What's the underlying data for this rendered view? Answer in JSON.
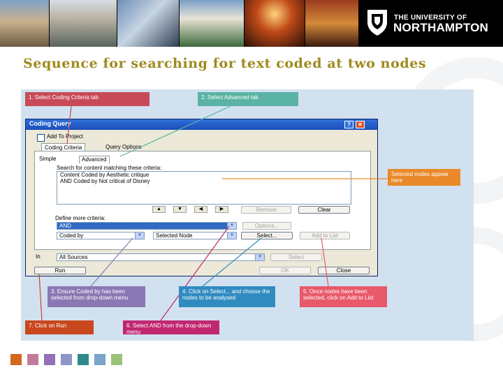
{
  "header": {
    "university_line1": "THE UNIVERSITY OF",
    "university_line2": "NORTHAMPTON"
  },
  "slide": {
    "title": "Sequence for searching for text coded at two nodes"
  },
  "dialog": {
    "title": "Coding Query",
    "help_button": "?",
    "close_button": "✕",
    "add_to_project_label": "Add To Project",
    "tabs": [
      "Coding Criteria",
      "Query Options"
    ],
    "subtabs": [
      "Simple",
      "Advanced"
    ],
    "search_label": "Search for content matching these criteria:",
    "criteria_lines": [
      "Content Coded by Aesthetic critique",
      "AND Coded by Not critical of Disney"
    ],
    "arrow_buttons": [
      "▲",
      "▼",
      "◀",
      "▶"
    ],
    "remove_button": "Remove",
    "clear_button": "Clear",
    "define_label": "Define more criteria:",
    "operator_value": "AND",
    "options_button": "Options...",
    "coded_by_value": "Coded by",
    "selected_node_value": "Selected Node",
    "select_button": "Select...",
    "add_to_list_button": "Add to List",
    "in_label": "In",
    "in_value": "All Sources",
    "in_select_button": "Select",
    "run_button": "Run",
    "ok_button": "OK",
    "close_dialog_button": "Close"
  },
  "callouts": {
    "step1": "1. Select Coding Criteria tab",
    "step2": "2. Select Advanced tab",
    "selected_nodes": "Selected nodes appear here",
    "step3": "3. Ensure Coded by has been selected from drop-down menu",
    "step4": "4. Click on Select... and choose the nodes to be analysed",
    "step5": "5. Once nodes have been selected, click on Add to List",
    "step6": "6. Select AND from the drop-down menu",
    "step7": "7. Click on Run"
  },
  "footer_colors": [
    "#d2691e",
    "#c37a9a",
    "#9370b8",
    "#8e95c9",
    "#2e8b8b",
    "#7aa4c8",
    "#9cc27a"
  ],
  "icons": {
    "university_logo": "northampton-shield-icon",
    "combo_arrow": "chevron-down-icon"
  }
}
